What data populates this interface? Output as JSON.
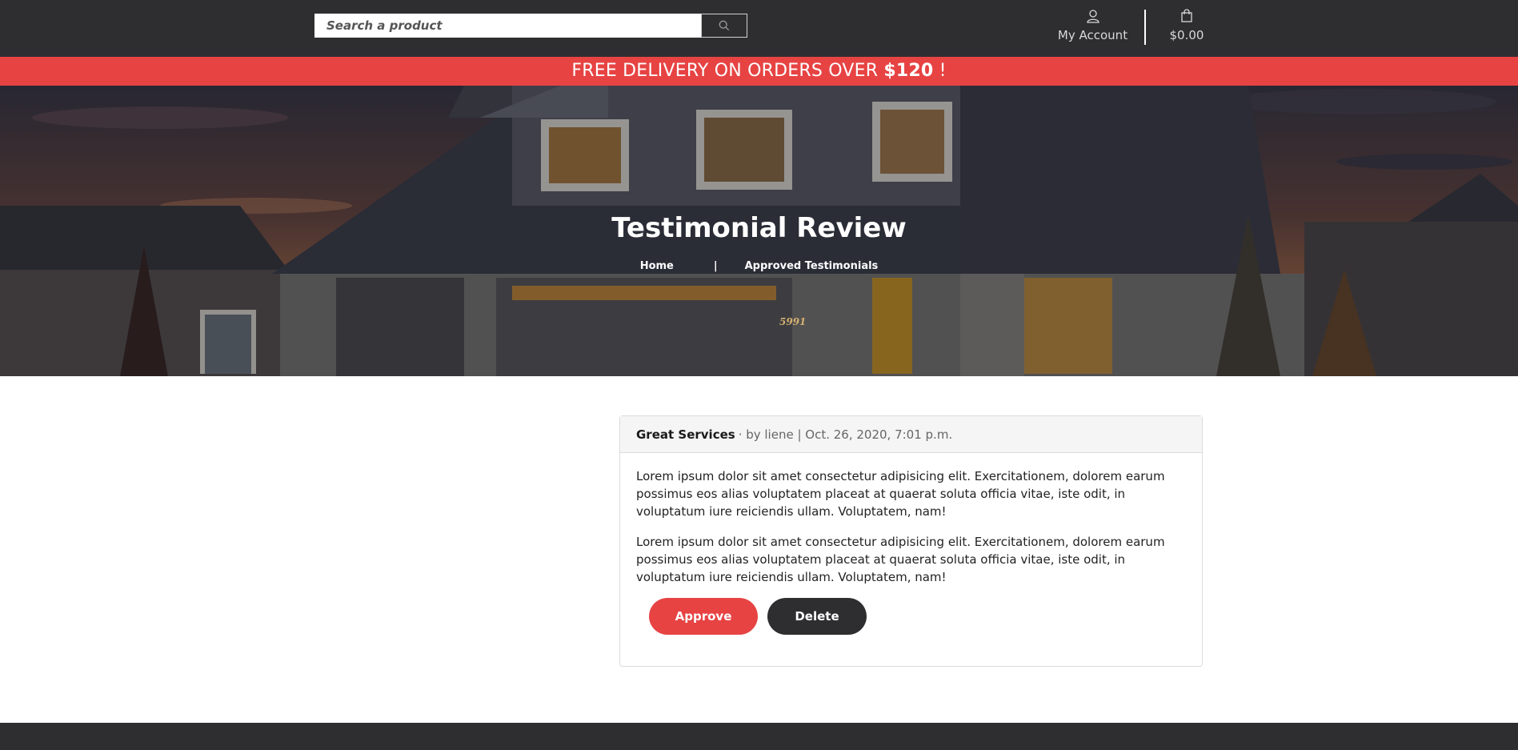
{
  "header": {
    "search": {
      "placeholder": "Search a product",
      "value": ""
    },
    "account_label": "My Account",
    "cart_total": "$0.00"
  },
  "promo": {
    "text_before": "FREE DELIVERY ON ORDERS OVER ",
    "amount": "$120",
    "text_after": " !"
  },
  "hero": {
    "title": "Testimonial Review",
    "house_number": "5991",
    "breadcrumb": {
      "home": "Home",
      "separator": "|",
      "current": "Approved Testimonials"
    }
  },
  "review": {
    "title": "Great Services",
    "meta": "· by liene | Oct. 26, 2020, 7:01 p.m.",
    "paragraphs": [
      "Lorem ipsum dolor sit amet consectetur adipisicing elit. Exercitationem, dolorem earum possimus eos alias voluptatem placeat at quaerat soluta officia vitae, iste odit, in voluptatum iure reiciendis ullam. Voluptatem, nam!",
      "Lorem ipsum dolor sit amet consectetur adipisicing elit. Exercitationem, dolorem earum possimus eos alias voluptatem placeat at quaerat soluta officia vitae, iste odit, in voluptatum iure reiciendis ullam. Voluptatem, nam!"
    ],
    "approve_label": "Approve",
    "delete_label": "Delete"
  },
  "icons": {
    "search": "search-icon",
    "account": "user-icon",
    "cart": "shopping-bag-icon"
  },
  "colors": {
    "header_bg": "#2e2e30",
    "accent": "#e74343",
    "dark_button": "#2e2e30"
  }
}
